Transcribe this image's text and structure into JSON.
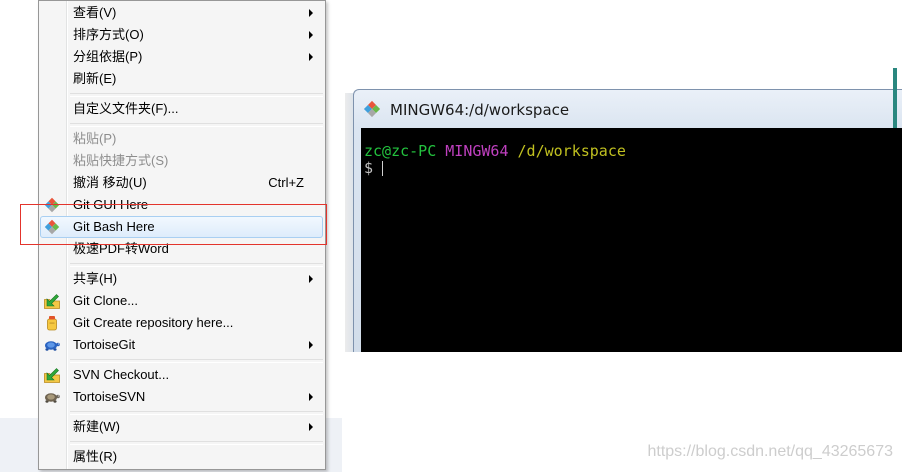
{
  "context_menu": {
    "items": [
      {
        "label": "查看(V)",
        "has_submenu": true
      },
      {
        "label": "排序方式(O)",
        "has_submenu": true
      },
      {
        "label": "分组依据(P)",
        "has_submenu": true
      },
      {
        "label": "刷新(E)"
      },
      {
        "label": "自定义文件夹(F)..."
      },
      {
        "label": "粘贴(P)",
        "disabled": true
      },
      {
        "label": "粘贴快捷方式(S)",
        "disabled": true
      },
      {
        "label": "撤消 移动(U)",
        "shortcut": "Ctrl+Z"
      },
      {
        "label": "Git GUI Here",
        "icon": "git-gui-icon"
      },
      {
        "label": "Git Bash Here",
        "icon": "git-bash-icon",
        "highlighted": true
      },
      {
        "label": "极速PDF转Word"
      },
      {
        "label": "共享(H)",
        "has_submenu": true
      },
      {
        "label": "Git Clone...",
        "icon": "git-clone-icon"
      },
      {
        "label": "Git Create repository here...",
        "icon": "git-create-repository-icon"
      },
      {
        "label": "TortoiseGit",
        "icon": "tortoisegit-icon",
        "has_submenu": true
      },
      {
        "label": "SVN Checkout...",
        "icon": "svn-checkout-icon"
      },
      {
        "label": "TortoiseSVN",
        "icon": "tortoisesvn-icon",
        "has_submenu": true
      },
      {
        "label": "新建(W)",
        "has_submenu": true
      },
      {
        "label": "属性(R)"
      }
    ]
  },
  "terminal": {
    "title": "MINGW64:/d/workspace",
    "title_icon": "git-bash-icon",
    "prompt": {
      "user_host": "zc@zc-PC",
      "system": "MINGW64",
      "path": "/d/workspace",
      "symbol": "$"
    }
  },
  "watermark": "https://blog.csdn.net/qq_43265673",
  "colors": {
    "user_host": "#23c23e",
    "system": "#bf40bf",
    "path": "#c0c020",
    "prompt_symbol": "#c0c0c0",
    "annotation_box": "#e3342c",
    "menu_highlight_border": "#a9cff2",
    "terminal_background": "#000000"
  }
}
